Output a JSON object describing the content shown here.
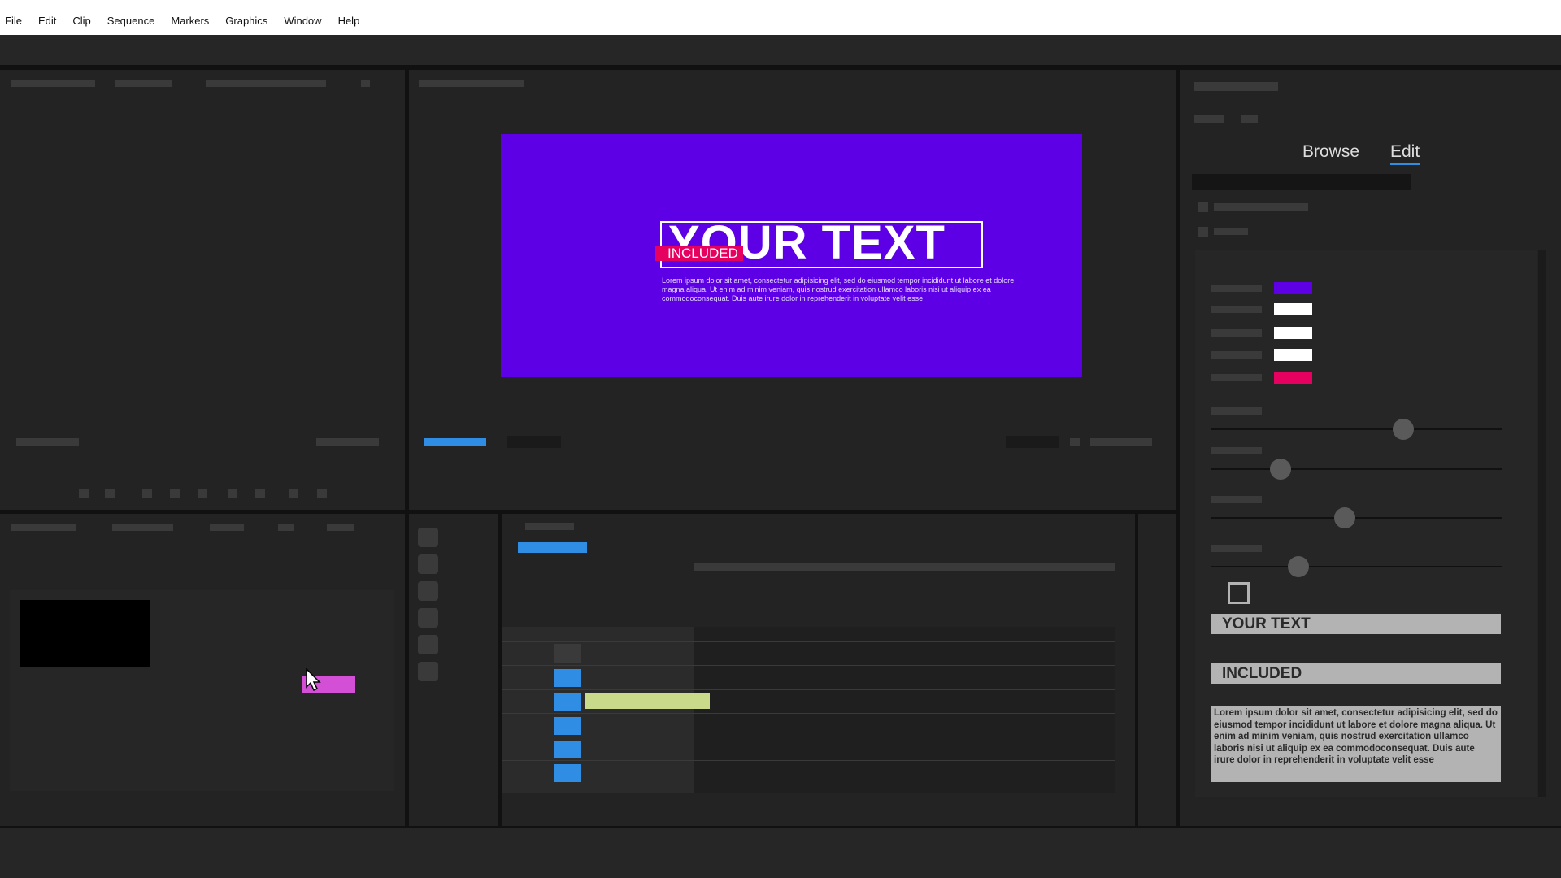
{
  "menu": [
    "File",
    "Edit",
    "Clip",
    "Sequence",
    "Markers",
    "Graphics",
    "Window",
    "Help"
  ],
  "preview": {
    "title": "YOUR TEXT",
    "subtitle": "INCLUDED",
    "body": "Lorem ipsum dolor sit amet, consectetur adipisicing elit, sed do eiusmod tempor incididunt ut labore et dolore magna aliqua. Ut enim ad minim veniam, quis nostrud exercitation ullamco laboris nisi ut aliquip ex ea commodoconsequat. Duis aute irure dolor in reprehenderit in voluptate velit esse",
    "background": "#5e00e6",
    "accent": "#e6005f"
  },
  "panel": {
    "tabs": [
      "Browse",
      "Edit"
    ],
    "active_tab": "Edit",
    "swatches": [
      "#5e00e6",
      "#ffffff",
      "#ffffff",
      "#ffffff",
      "#e6005f"
    ],
    "sliders": [
      0.66,
      0.24,
      0.46,
      0.3
    ],
    "checkbox_checked": false,
    "field_title": "YOUR TEXT",
    "field_subtitle": "INCLUDED",
    "field_body": "Lorem ipsum dolor sit amet, consectetur adipisicing elit, sed do eiusmod tempor incididunt ut labore et dolore magna aliqua. Ut enim ad minim veniam, quis nostrud exercitation ullamco laboris nisi ut aliquip ex ea commodoconsequat. Duis aute irure dolor in reprehenderit in voluptate velit esse"
  },
  "colors": {
    "timeline_clip": "#c9db8a",
    "project_clip": "#d24fd6",
    "track_blue": "#2f8de4"
  }
}
